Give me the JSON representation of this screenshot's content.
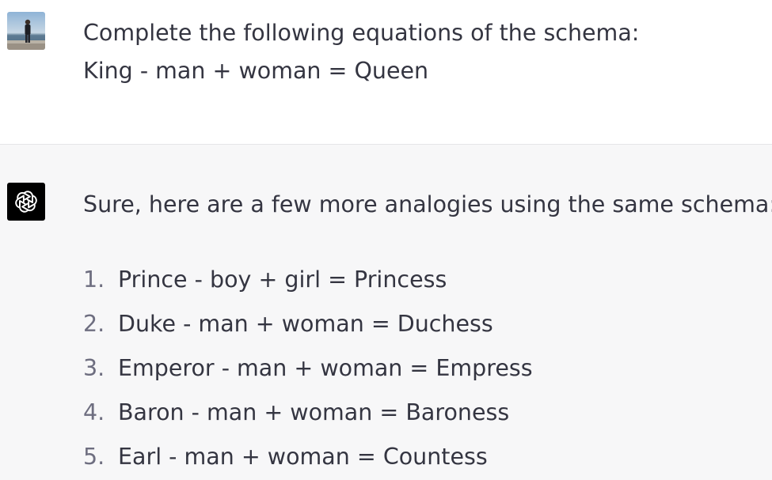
{
  "user_turn": {
    "avatar": "user-photo-avatar",
    "lines": [
      "Complete the following equations of the schema:",
      "King - man + woman = Queen"
    ]
  },
  "assistant_turn": {
    "avatar": "openai-logo-icon",
    "avatar_bg": "#000000",
    "intro": "Sure, here are a few more analogies using the same schema:",
    "items": [
      {
        "num": "1.",
        "text": "Prince - boy + girl = Princess"
      },
      {
        "num": "2.",
        "text": "Duke - man + woman = Duchess"
      },
      {
        "num": "3.",
        "text": "Emperor - man + woman = Empress"
      },
      {
        "num": "4.",
        "text": "Baron - man + woman = Baroness"
      },
      {
        "num": "5.",
        "text": "Earl - man + woman = Countess"
      }
    ]
  },
  "colors": {
    "text": "#343541",
    "list_number": "#6e6e80",
    "assistant_bg": "#f7f7f8",
    "divider": "#e5e5e8"
  }
}
